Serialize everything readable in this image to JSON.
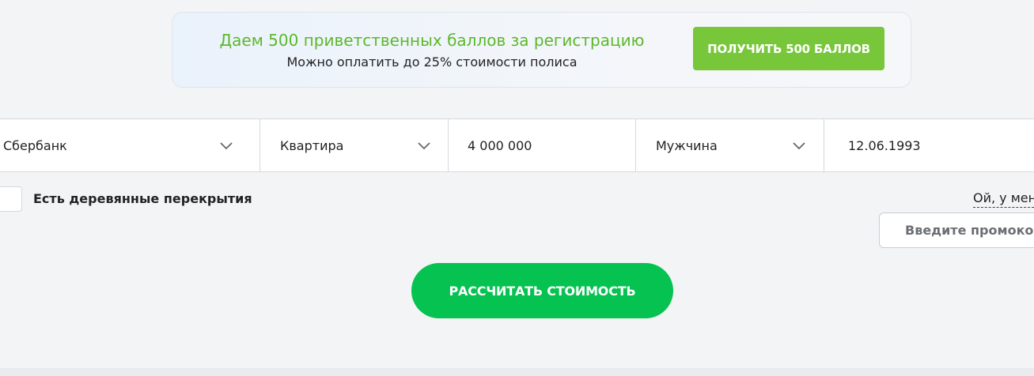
{
  "banner": {
    "title": "Даем 500 приветственных баллов за регистрацию",
    "subtitle": "Можно оплатить до 25% стоимости полиса",
    "button_label": "ПОЛУЧИТЬ 500 БАЛЛОВ",
    "title_color": "#5cb82a",
    "button_color": "#78c63a"
  },
  "form": {
    "bank": {
      "value": "Сбербанк",
      "icon": "chevron-down-icon"
    },
    "property_type": {
      "value": "Квартира",
      "icon": "chevron-down-icon"
    },
    "amount": {
      "value": "4 000 000"
    },
    "gender": {
      "value": "Мужчина",
      "icon": "chevron-down-icon"
    },
    "birth_date": {
      "value": "12.06.1993"
    }
  },
  "options": {
    "wooden_floors_label": "Есть деревянные перекрытия",
    "wooden_floors_checked": false,
    "oops_link": "Ой, у мен"
  },
  "promo": {
    "placeholder": "Введите промокод"
  },
  "calculate": {
    "button_label": "РАССЧИТАТЬ СТОИМОСТЬ",
    "button_color": "#05c251"
  }
}
